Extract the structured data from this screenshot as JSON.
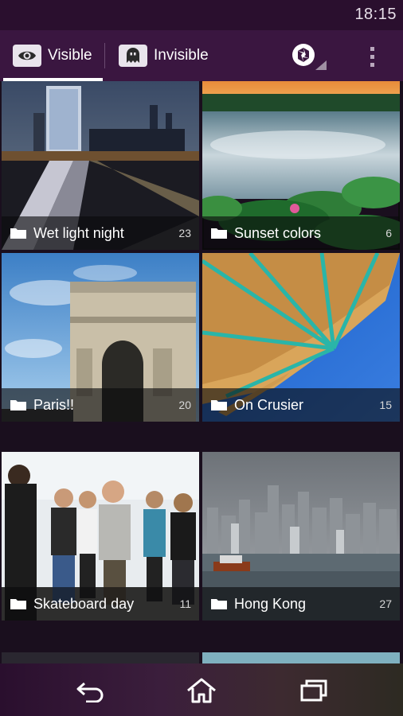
{
  "status_bar": {
    "time": "18:15"
  },
  "action_bar": {
    "tabs": [
      {
        "label": "Visible",
        "icon": "eye-icon",
        "selected": true
      },
      {
        "label": "Invisible",
        "icon": "ghost-icon",
        "selected": false
      }
    ],
    "actions": [
      {
        "icon": "aperture-icon"
      },
      {
        "icon": "overflow-menu-icon"
      }
    ]
  },
  "albums": [
    {
      "title": "Wet light night",
      "count": "23"
    },
    {
      "title": "Sunset colors",
      "count": "6"
    },
    {
      "title": "Paris!!",
      "count": "20"
    },
    {
      "title": "On Crusier",
      "count": "15"
    },
    {
      "title": "Skateboard day",
      "count": "11"
    },
    {
      "title": "Hong Kong",
      "count": "27"
    }
  ],
  "nav_bar": {
    "buttons": [
      {
        "icon": "back-icon"
      },
      {
        "icon": "home-icon"
      },
      {
        "icon": "recent-apps-icon"
      }
    ]
  },
  "colors": {
    "status_bar": "#2a0f2e",
    "action_bar": "#3a1640",
    "accent": "#ffffff"
  }
}
